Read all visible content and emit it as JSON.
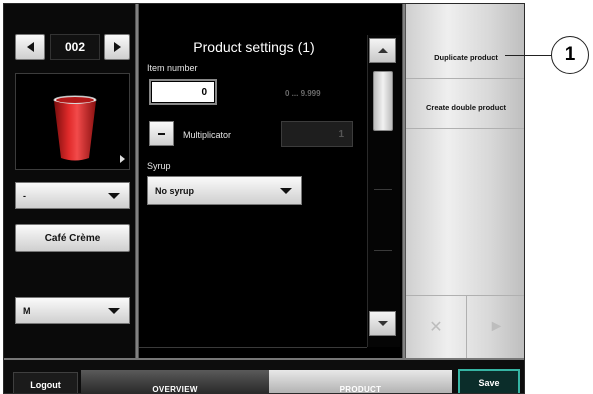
{
  "counter": {
    "value": "002",
    "prev_icon": "left-arrow-icon",
    "next_icon": "right-arrow-icon"
  },
  "cup": {
    "icon": "red-cup-icon",
    "cup_color": "#c81e1e"
  },
  "left": {
    "dropdown_top": "-",
    "product_button": "Café Crème",
    "dropdown_size": "M"
  },
  "settings": {
    "title": "Product settings (1)",
    "item_number_label": "Item number",
    "item_number_value": "0",
    "item_number_range": "0 ... 9.999",
    "multiplicator_label": "Multiplicator",
    "multiplicator_value": "1",
    "syrup_label": "Syrup",
    "syrup_value": "No syrup"
  },
  "right_menu": {
    "duplicate": "Duplicate product",
    "double": "Create double product",
    "cancel_icon": "x-icon",
    "forward_icon": "play-icon"
  },
  "bottom": {
    "logout": "Logout",
    "tab_overview": "OVERVIEW",
    "tab_product": "PRODUCT",
    "save": "Save"
  },
  "callout": {
    "number": "1"
  },
  "colors": {
    "accent_save": "#36b5a4"
  }
}
